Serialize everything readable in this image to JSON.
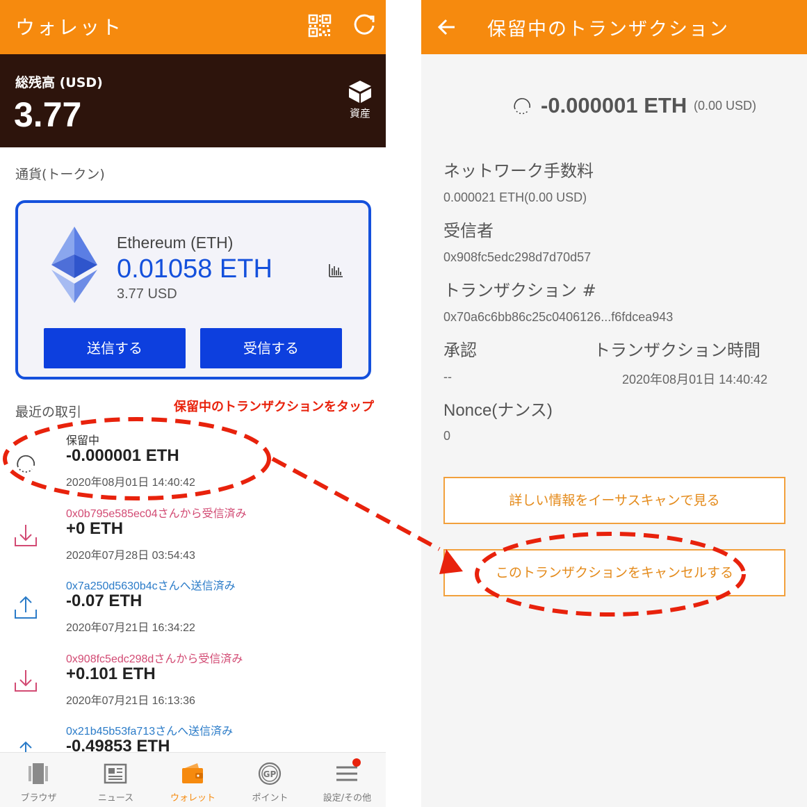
{
  "wallet": {
    "title": "ウォレット",
    "balance_label": "総残高 (USD)",
    "balance_value": "3.77",
    "assets_label": "資産",
    "section_tokens": "通貨(トークン)",
    "token": {
      "name": "Ethereum (ETH)",
      "amount": "0.01058 ETH",
      "usd": "3.77 USD",
      "send_label": "送信する",
      "receive_label": "受信する"
    },
    "section_recent": "最近の取引",
    "annotation": "保留中のトランザクションをタップ",
    "transactions": [
      {
        "line1": "保留中",
        "amount": "-0.000001 ETH",
        "date": "2020年08月01日 14:40:42",
        "kind": "pending"
      },
      {
        "line1": "0x0b795e585ec04さんから受信済み",
        "amount": "+0 ETH",
        "date": "2020年07月28日 03:54:43",
        "kind": "received"
      },
      {
        "line1": "0x7a250d5630b4cさんへ送信済み",
        "amount": "-0.07 ETH",
        "date": "2020年07月21日 16:34:22",
        "kind": "sent"
      },
      {
        "line1": "0x908fc5edc298dさんから受信済み",
        "amount": "+0.101 ETH",
        "date": "2020年07月21日 16:13:36",
        "kind": "received"
      },
      {
        "line1": "0x21b45b53fa713さんへ送信済み",
        "amount": "-0.49853 ETH",
        "date": "",
        "kind": "sent"
      }
    ],
    "nav": [
      {
        "label": "ブラウザ",
        "icon": "browser-icon"
      },
      {
        "label": "ニュース",
        "icon": "news-icon"
      },
      {
        "label": "ウォレット",
        "icon": "wallet-icon",
        "active": true
      },
      {
        "label": "ポイント",
        "icon": "gp-points-icon"
      },
      {
        "label": "設定/その他",
        "icon": "menu-icon"
      }
    ]
  },
  "detail": {
    "title": "保留中のトランザクション",
    "amount": "-0.000001 ETH",
    "amount_usd": "(0.00 USD)",
    "fee_label": "ネットワーク手数料",
    "fee_value": "0.000021 ETH(0.00 USD)",
    "recipient_label": "受信者",
    "recipient_value": "0x908fc5edc298d7d70d57",
    "txid_label": "トランザクション #",
    "txid_value": "0x70a6c6bb86c25c0406126...f6fdcea943",
    "confirm_label": "承認",
    "confirm_value": "--",
    "time_label": "トランザクション時間",
    "time_value": "2020年08月01日 14:40:42",
    "nonce_label": "Nonce(ナンス)",
    "nonce_value": "0",
    "etherscan_button": "詳しい情報をイーサスキャンで見る",
    "cancel_button": "このトランザクションをキャンセルする"
  },
  "colors": {
    "accent_orange": "#f68a0e",
    "balance_bg": "#2d140c",
    "primary_blue": "#0d3fde",
    "annotation_red": "#e8220c",
    "received_pink": "#d24a73",
    "sent_blue": "#2a7bc8"
  }
}
